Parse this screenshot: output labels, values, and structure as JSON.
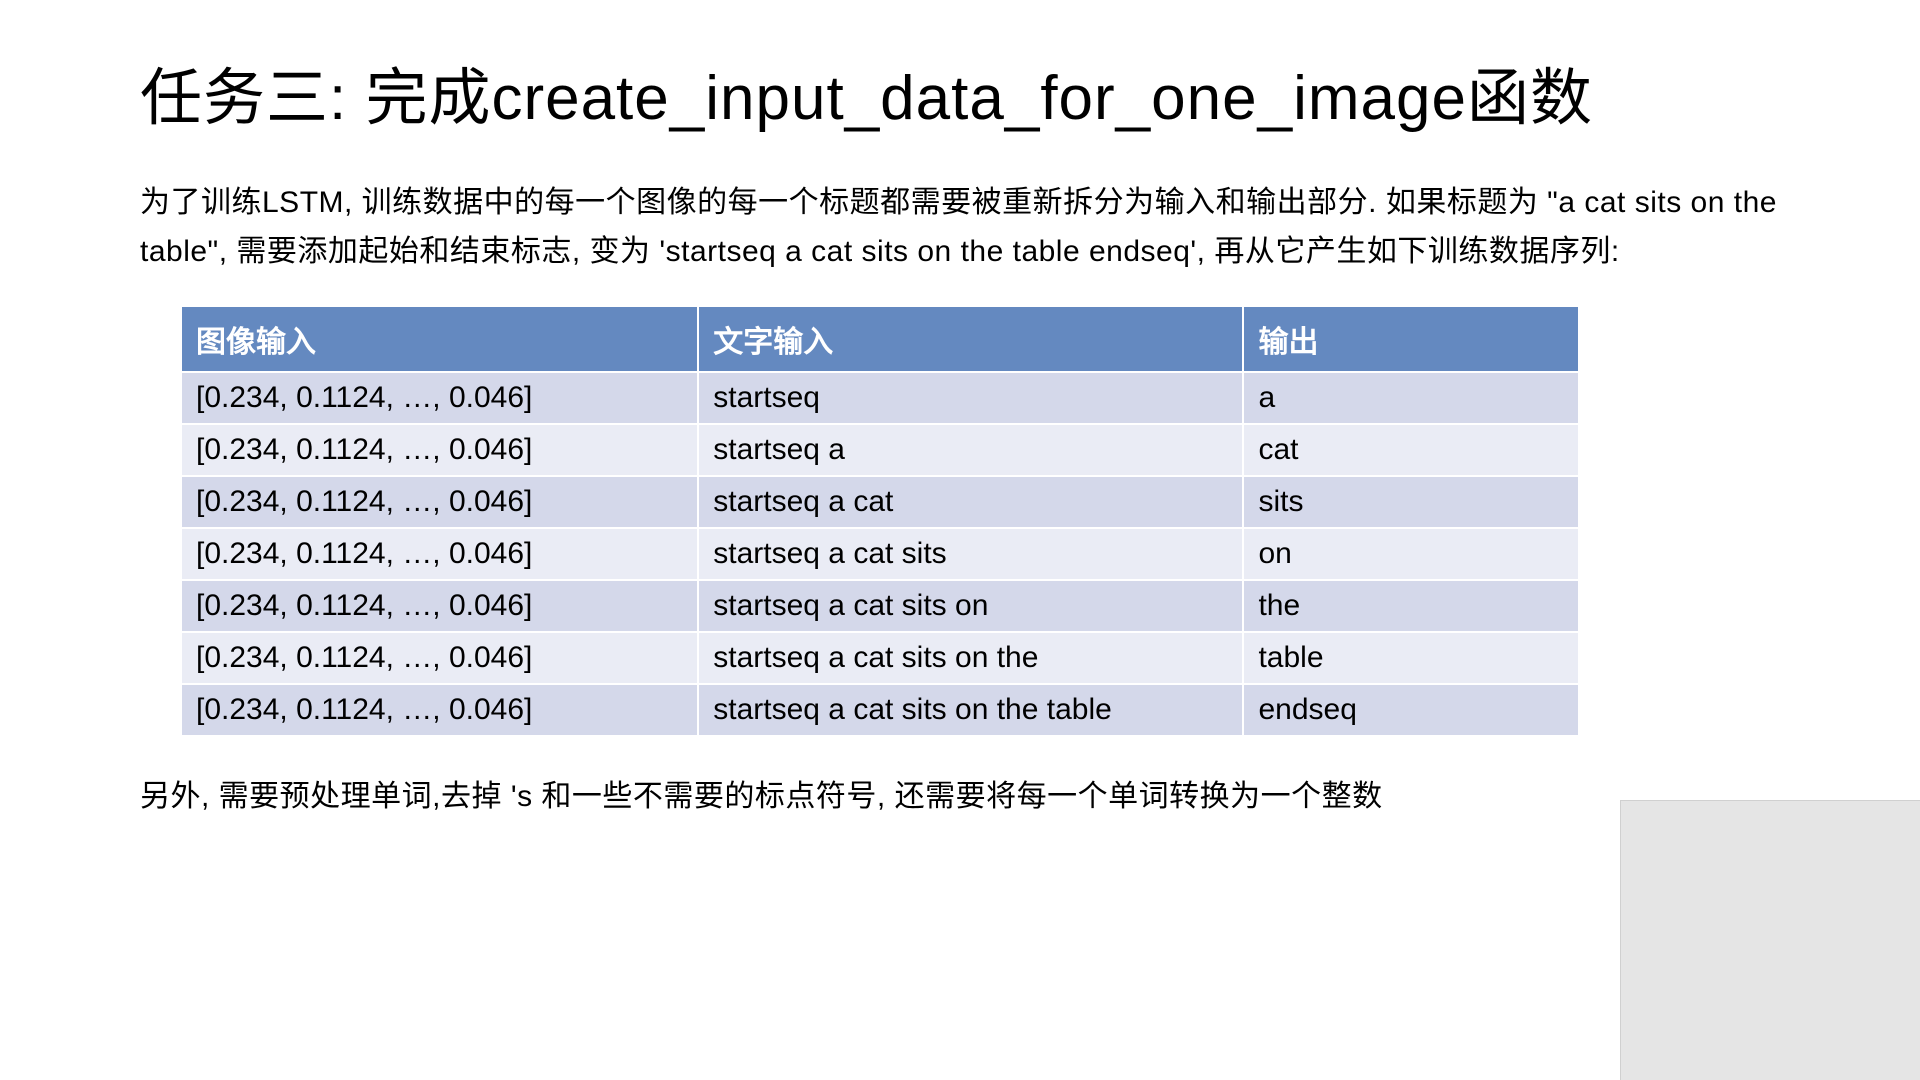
{
  "title": "任务三: 完成create_input_data_for_one_image函数",
  "description": "为了训练LSTM, 训练数据中的每一个图像的每一个标题都需要被重新拆分为输入和输出部分. 如果标题为 \"a cat sits on the table\", 需要添加起始和结束标志, 变为 'startseq a cat sits on the table endseq', 再从它产生如下训练数据序列:",
  "table": {
    "headers": [
      "图像输入",
      "文字输入",
      "输出"
    ],
    "rows": [
      {
        "image": "[0.234, 0.1124, …, 0.046]",
        "text": "startseq",
        "output": "a"
      },
      {
        "image": "[0.234, 0.1124, …, 0.046]",
        "text": "startseq a",
        "output": "cat"
      },
      {
        "image": "[0.234, 0.1124, …, 0.046]",
        "text": "startseq a cat",
        "output": "sits"
      },
      {
        "image": "[0.234, 0.1124, …, 0.046]",
        "text": "startseq a cat sits",
        "output": "on"
      },
      {
        "image": "[0.234, 0.1124, …, 0.046]",
        "text": "startseq a cat sits on",
        "output": "the"
      },
      {
        "image": "[0.234, 0.1124, …, 0.046]",
        "text": "startseq a cat sits on the",
        "output": "table"
      },
      {
        "image": "[0.234, 0.1124, …, 0.046]",
        "text": "startseq a cat sits on the table",
        "output": "endseq"
      }
    ]
  },
  "footnote": "另外, 需要预处理单词,去掉 's 和一些不需要的标点符号, 还需要将每一个单词转换为一个整数"
}
